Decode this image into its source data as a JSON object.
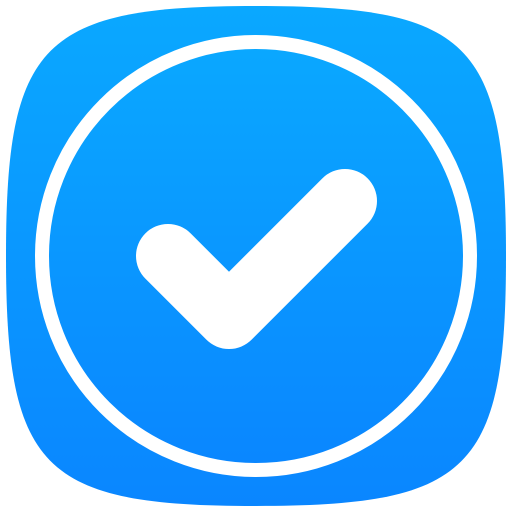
{
  "app_icon": {
    "icon": "checkmark-in-circle-icon",
    "colors": {
      "background_top": "#0AA8FF",
      "background_bottom": "#0A86FF",
      "ring": "#FFFFFF",
      "check": "#FFFFFF"
    }
  }
}
